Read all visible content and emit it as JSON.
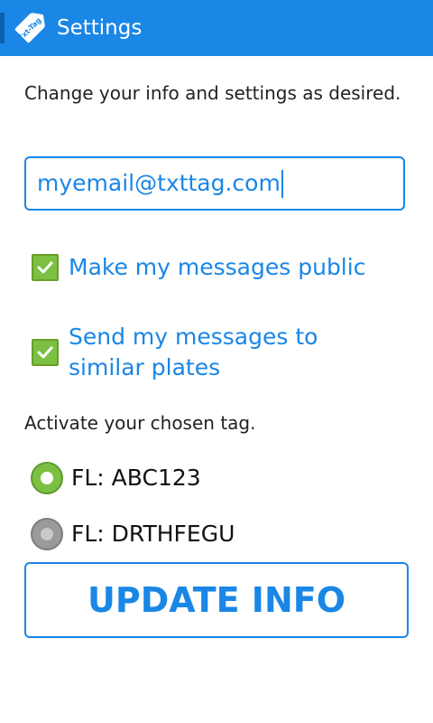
{
  "app": {
    "logo_text": "Txt-Tag",
    "title": "Settings",
    "accent_color": "#1a86e6",
    "check_color": "#7bc043"
  },
  "form": {
    "intro": "Change your info and settings as desired.",
    "email_value": "myemail@txttag.com",
    "checkboxes": [
      {
        "label": "Make my messages public",
        "checked": true
      },
      {
        "label": "Send my messages to similar plates",
        "checked": true
      }
    ],
    "tag_section_label": "Activate your chosen tag.",
    "tags": [
      {
        "label": "FL: ABC123",
        "selected": true
      },
      {
        "label": "FL: DRTHFEGU",
        "selected": false
      }
    ],
    "update_label": "UPDATE INFO"
  }
}
